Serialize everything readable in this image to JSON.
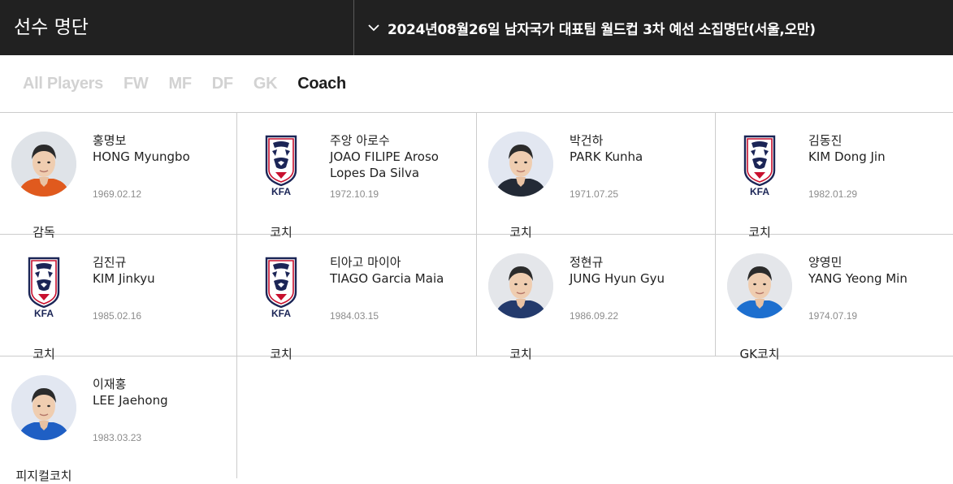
{
  "header": {
    "title": "선수 명단",
    "roster_select": "2024년08월26일 남자국가 대표팀 월드컵 3차 예선 소집명단(서울,오만)"
  },
  "tabs": [
    {
      "label": "All Players",
      "active": false
    },
    {
      "label": "FW",
      "active": false
    },
    {
      "label": "MF",
      "active": false
    },
    {
      "label": "DF",
      "active": false
    },
    {
      "label": "GK",
      "active": false
    },
    {
      "label": "Coach",
      "active": true
    }
  ],
  "kfa_label": "KFA",
  "staff": [
    {
      "name_ko": "홍명보",
      "name_en": "HONG Myungbo",
      "birth": "1969.02.12",
      "role": "감독",
      "photo": "portrait",
      "jersey": "#e05a1e",
      "bg": "#dfe3e8"
    },
    {
      "name_ko": "주앙 아로수",
      "name_en": "JOAO FILIPE Aroso Lopes Da Silva",
      "birth": "1972.10.19",
      "role": "코치",
      "photo": "kfa-logo"
    },
    {
      "name_ko": "박건하",
      "name_en": "PARK Kunha",
      "birth": "1971.07.25",
      "role": "코치",
      "photo": "portrait",
      "jersey": "#232a36",
      "bg": "#e2e7f1"
    },
    {
      "name_ko": "김동진",
      "name_en": "KIM Dong Jin",
      "birth": "1982.01.29",
      "role": "코치",
      "photo": "kfa-logo"
    },
    {
      "name_ko": "김진규",
      "name_en": "KIM Jinkyu",
      "birth": "1985.02.16",
      "role": "코치",
      "photo": "kfa-logo"
    },
    {
      "name_ko": "티아고 마이아",
      "name_en": "TIAGO Garcia Maia",
      "birth": "1984.03.15",
      "role": "코치",
      "photo": "kfa-logo"
    },
    {
      "name_ko": "정현규",
      "name_en": "JUNG Hyun Gyu",
      "birth": "1986.09.22",
      "role": "코치",
      "photo": "portrait",
      "jersey": "#233a6c",
      "bg": "#e4e6ea"
    },
    {
      "name_ko": "양영민",
      "name_en": "YANG Yeong Min",
      "birth": "1974.07.19",
      "role": "GK코치",
      "photo": "portrait",
      "jersey": "#1d6fcf",
      "bg": "#e4e6ea"
    },
    {
      "name_ko": "이재홍",
      "name_en": "LEE Jaehong",
      "birth": "1983.03.23",
      "role": "피지컬코치",
      "photo": "portrait",
      "jersey": "#1f5fc4",
      "bg": "#e2e7f1"
    }
  ],
  "colors": {
    "header_bg": "#212121",
    "tab_inactive": "#d2d2d2",
    "tab_active": "#1e1e1e",
    "kfa_red": "#c8102e",
    "kfa_navy": "#1b2556",
    "birth_text": "#8c8c8c"
  }
}
